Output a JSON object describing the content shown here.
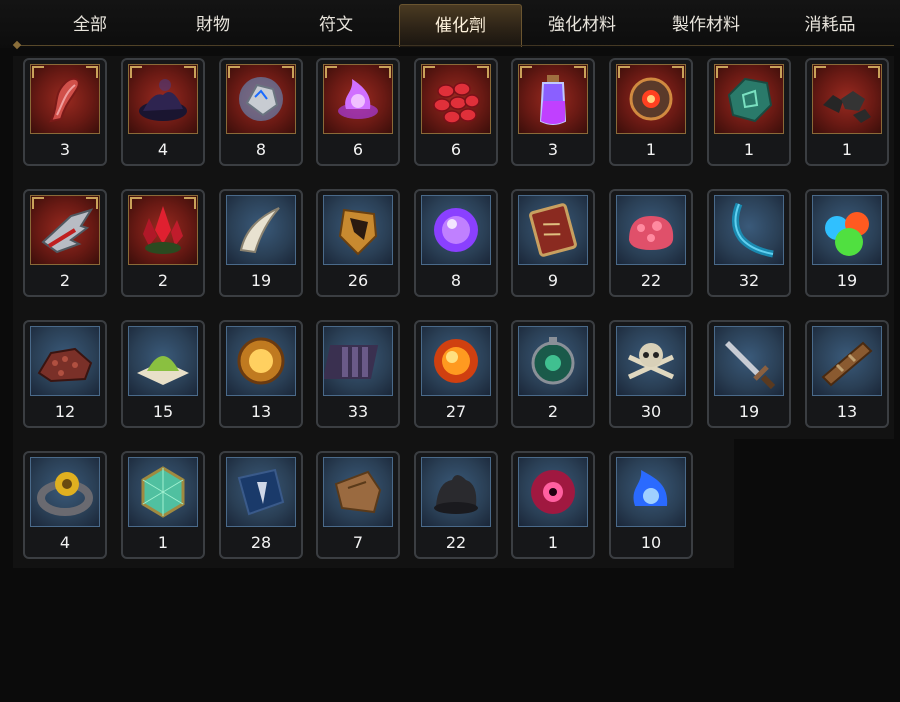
{
  "tabs": [
    {
      "label": "全部",
      "active": false
    },
    {
      "label": "財物",
      "active": false
    },
    {
      "label": "符文",
      "active": false
    },
    {
      "label": "催化劑",
      "active": true
    },
    {
      "label": "強化材料",
      "active": false
    },
    {
      "label": "製作材料",
      "active": false
    },
    {
      "label": "消耗品",
      "active": false
    }
  ],
  "items": [
    {
      "icon": "red-twisted-horn-icon",
      "count": "3"
    },
    {
      "icon": "dark-ash-pile-icon",
      "count": "4"
    },
    {
      "icon": "blue-lightning-stone-icon",
      "count": "8"
    },
    {
      "icon": "purple-flame-icon",
      "count": "6"
    },
    {
      "icon": "red-scales-icon",
      "count": "6"
    },
    {
      "icon": "purple-potion-vial-icon",
      "count": "3"
    },
    {
      "icon": "ancient-mechanism-orb-icon",
      "count": "1"
    },
    {
      "icon": "green-rune-shard-icon",
      "count": "1"
    },
    {
      "icon": "black-ore-chunks-icon",
      "count": "1"
    },
    {
      "icon": "spiked-red-claw-icon",
      "count": "2"
    },
    {
      "icon": "red-crystal-cluster-icon",
      "count": "2"
    },
    {
      "icon": "bone-fang-icon",
      "count": "19"
    },
    {
      "icon": "golden-shield-shard-icon",
      "count": "26"
    },
    {
      "icon": "violet-energy-orb-icon",
      "count": "8"
    },
    {
      "icon": "demonic-tome-icon",
      "count": "9"
    },
    {
      "icon": "pink-flesh-blob-icon",
      "count": "22"
    },
    {
      "icon": "blue-spine-tail-icon",
      "count": "32"
    },
    {
      "icon": "colored-orbs-icon",
      "count": "19"
    },
    {
      "icon": "red-ore-pile-icon",
      "count": "12"
    },
    {
      "icon": "green-powder-icon",
      "count": "15"
    },
    {
      "icon": "sun-amulet-icon",
      "count": "13"
    },
    {
      "icon": "dark-scales-plate-icon",
      "count": "33"
    },
    {
      "icon": "molten-orb-icon",
      "count": "27"
    },
    {
      "icon": "emerald-compass-icon",
      "count": "2"
    },
    {
      "icon": "skull-crossbones-icon",
      "count": "30"
    },
    {
      "icon": "steel-dagger-icon",
      "count": "19"
    },
    {
      "icon": "wooden-splint-icon",
      "count": "13"
    },
    {
      "icon": "gold-gear-ring-icon",
      "count": "4"
    },
    {
      "icon": "teal-gem-icon",
      "count": "1"
    },
    {
      "icon": "blue-cloth-emblem-icon",
      "count": "28"
    },
    {
      "icon": "leather-scrap-icon",
      "count": "7"
    },
    {
      "icon": "tar-lump-icon",
      "count": "22"
    },
    {
      "icon": "demon-eye-orb-icon",
      "count": "1"
    },
    {
      "icon": "blue-spirit-flame-icon",
      "count": "10"
    }
  ],
  "colors": {
    "accent": "#c9a25a",
    "tab_active": "#4a3a22",
    "red_frame": "#9a2a20",
    "blue_frame": "#3a5a7a"
  }
}
